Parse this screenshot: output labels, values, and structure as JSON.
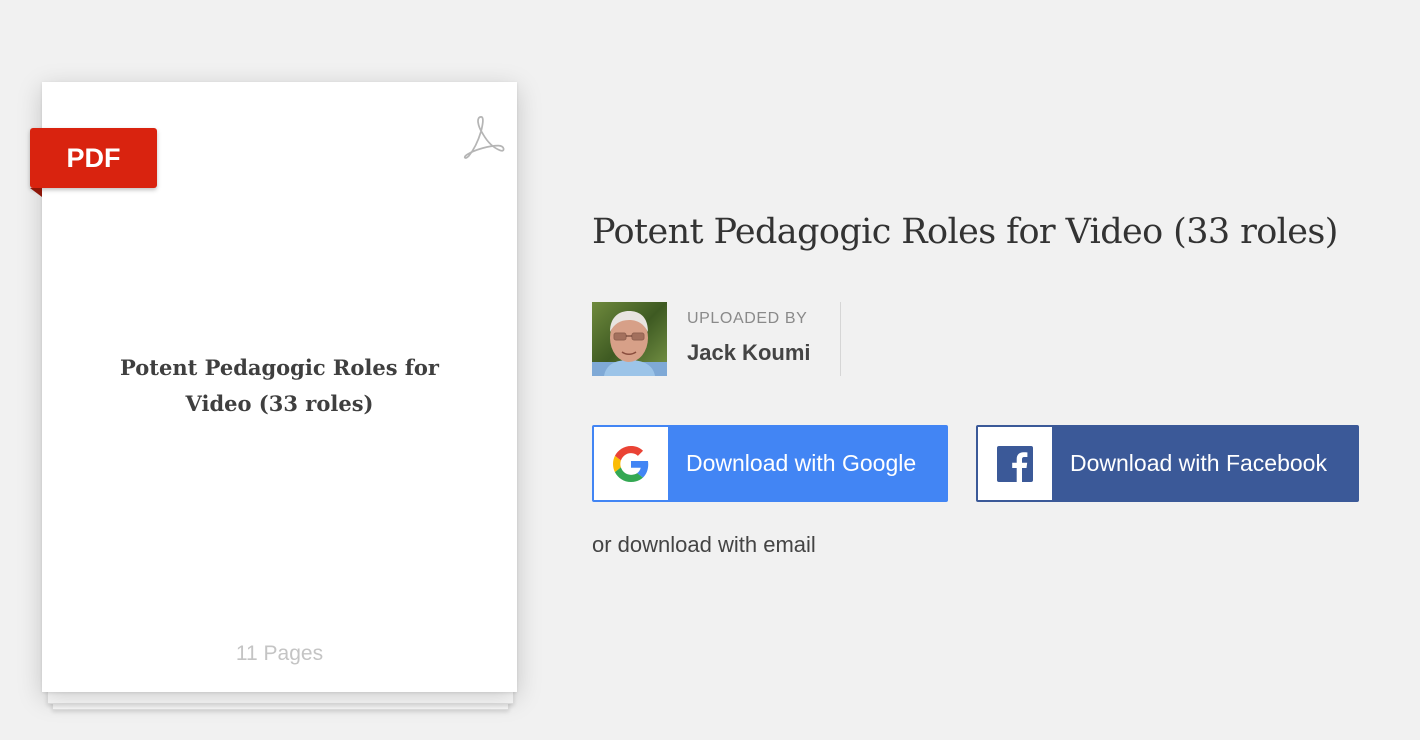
{
  "document": {
    "badge": "PDF",
    "title": "Potent Pedagogic Roles for Video (33 roles)",
    "pages": "11 Pages",
    "file_type_icon": "acrobat-pdf-icon"
  },
  "main": {
    "title": "Potent Pedagogic Roles for Video (33 roles)"
  },
  "uploader": {
    "label": "UPLOADED BY",
    "name": "Jack Koumi"
  },
  "actions": {
    "google_label": "Download with Google",
    "facebook_label": "Download with Facebook",
    "email_label": "or download with email"
  },
  "colors": {
    "background": "#f1f1f1",
    "pdf_badge": "#d9230f",
    "google_blue": "#4285f4",
    "facebook_blue": "#3b5998"
  }
}
